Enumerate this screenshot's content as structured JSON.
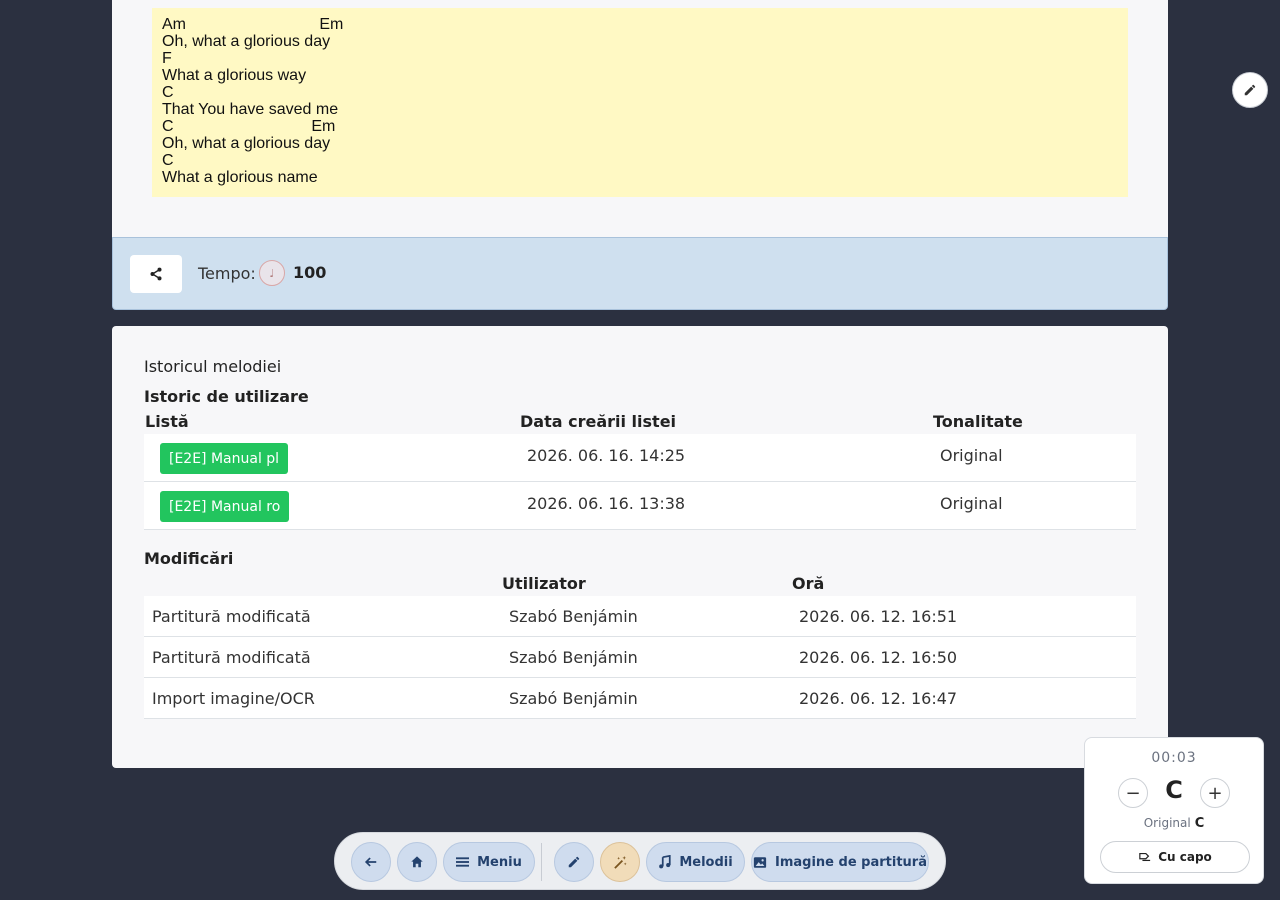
{
  "lyrics": {
    "lines": [
      "Am                              Em",
      "Oh, what a glorious day",
      "F",
      "What a glorious way",
      "C",
      "That You have saved me",
      "C                               Em",
      "Oh, what a glorious day",
      "C",
      "What a glorious name"
    ]
  },
  "tempo": {
    "label": "Tempo:",
    "value": "100",
    "metronome_icon": "♩"
  },
  "history": {
    "title": "Istoricul melodiei",
    "usage_title": "Istoric de utilizare",
    "usage_headers": {
      "list": "Listă",
      "date": "Data creării listei",
      "key": "Tonalitate"
    },
    "usage_rows": [
      {
        "list": "[E2E] Manual pl",
        "date": "2026. 06. 16. 14:25",
        "key": "Original"
      },
      {
        "list": "[E2E] Manual ro",
        "date": "2026. 06. 16. 13:38",
        "key": "Original"
      }
    ],
    "changes_title": "Modificări",
    "changes_headers": {
      "user": "Utilizator",
      "time": "Oră"
    },
    "changes_rows": [
      {
        "action": "Partitură modificată",
        "user": "Szabó Benjámin",
        "time": "2026. 06. 12. 16:51"
      },
      {
        "action": "Partitură modificată",
        "user": "Szabó Benjámin",
        "time": "2026. 06. 12. 16:50"
      },
      {
        "action": "Import imagine/OCR",
        "user": "Szabó Benjámin",
        "time": "2026. 06. 12. 16:47"
      }
    ]
  },
  "toolbar": {
    "menu_label": "Meniu",
    "songs_label": "Melodii",
    "sheet_image_label": "Imagine de partitură"
  },
  "transpose": {
    "timer": "00:03",
    "minus": "−",
    "plus": "+",
    "current_key": "C",
    "original_label": "Original",
    "original_key": "C",
    "capo_label": "Cu capo"
  },
  "colors": {
    "background": "#2b3040",
    "lyrics_highlight": "#fff9c4",
    "tempo_bar": "#cfe0ef",
    "list_tag": "#22c55e",
    "toolbar_button": "#cfdcee",
    "toolbar_gold_button": "#f1dcb9"
  }
}
